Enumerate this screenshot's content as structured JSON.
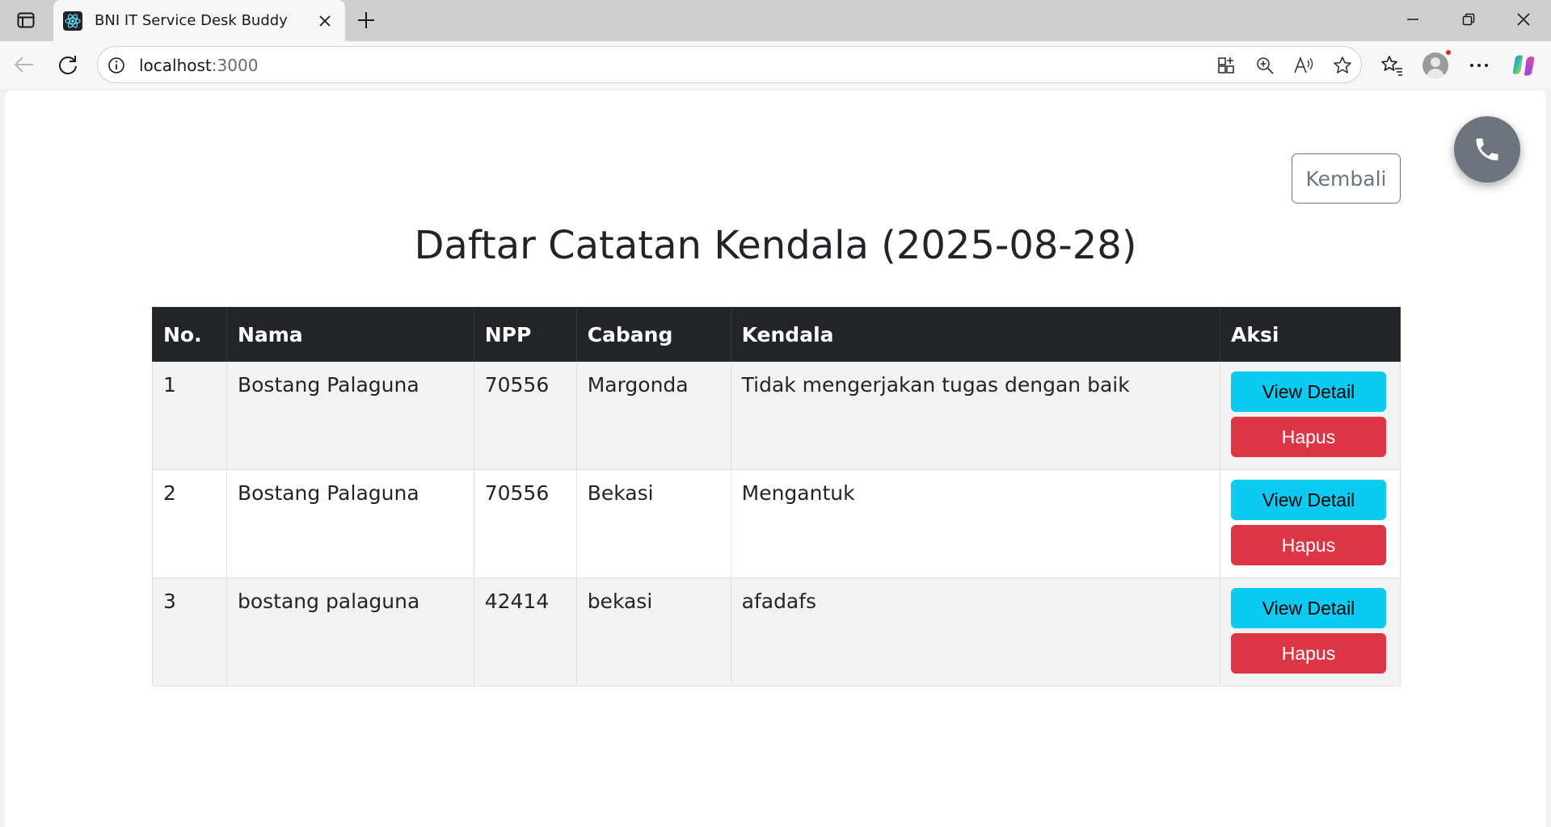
{
  "browser": {
    "tab": {
      "title": "BNI IT Service Desk Buddy"
    },
    "address": {
      "host": "localhost",
      "port": ":3000"
    }
  },
  "page": {
    "back_label": "Kembali",
    "title": "Daftar Catatan Kendala (2025-08-28)",
    "table": {
      "headers": [
        "No.",
        "Nama",
        "NPP",
        "Cabang",
        "Kendala",
        "Aksi"
      ],
      "rows": [
        {
          "no": "1",
          "nama": "Bostang Palaguna",
          "npp": "70556",
          "cabang": "Margonda",
          "kendala": "Tidak mengerjakan tugas dengan baik"
        },
        {
          "no": "2",
          "nama": "Bostang Palaguna",
          "npp": "70556",
          "cabang": "Bekasi",
          "kendala": "Mengantuk"
        },
        {
          "no": "3",
          "nama": "bostang palaguna",
          "npp": "42414",
          "cabang": "bekasi",
          "kendala": "afadafs"
        }
      ],
      "view_detail_label": "View Detail",
      "delete_label": "Hapus"
    }
  },
  "colors": {
    "header_bg": "#212529",
    "detail_button": "#0dcaf0",
    "delete_button": "#dc3545",
    "secondary": "#6c757d"
  }
}
